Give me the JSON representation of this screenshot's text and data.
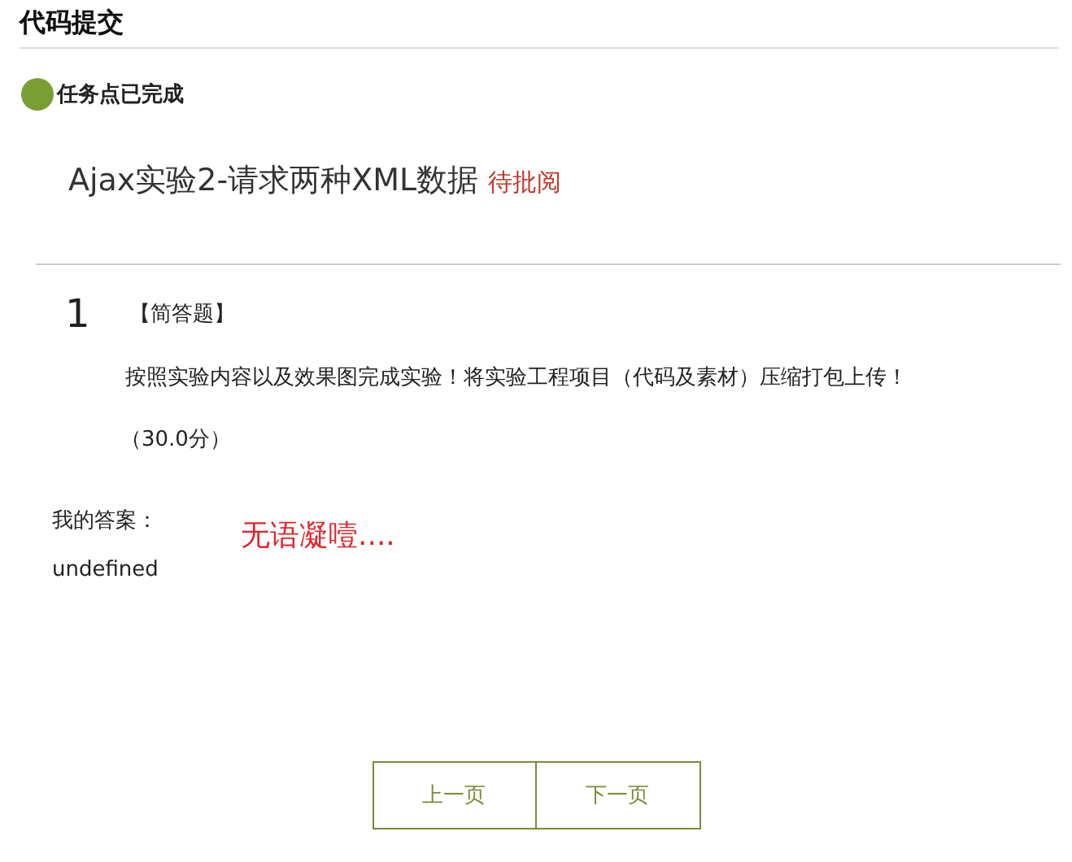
{
  "header": {
    "title": "代码提交"
  },
  "task_status": {
    "label": "任务点已完成",
    "completed": true
  },
  "assignment": {
    "title": "Ajax实验2-请求两种XML数据",
    "status": "待批阅"
  },
  "question": {
    "number": "1",
    "type": "【简答题】",
    "text": "按照实验内容以及效果图完成实验！将实验工程项目（代码及素材）压缩打包上传！",
    "score": "（30.0分）"
  },
  "answer": {
    "label": "我的答案：",
    "annotation": "无语凝噎....",
    "value": "undefined"
  },
  "pagination": [
    {
      "label": "上一页"
    },
    {
      "label": "下一页"
    }
  ]
}
